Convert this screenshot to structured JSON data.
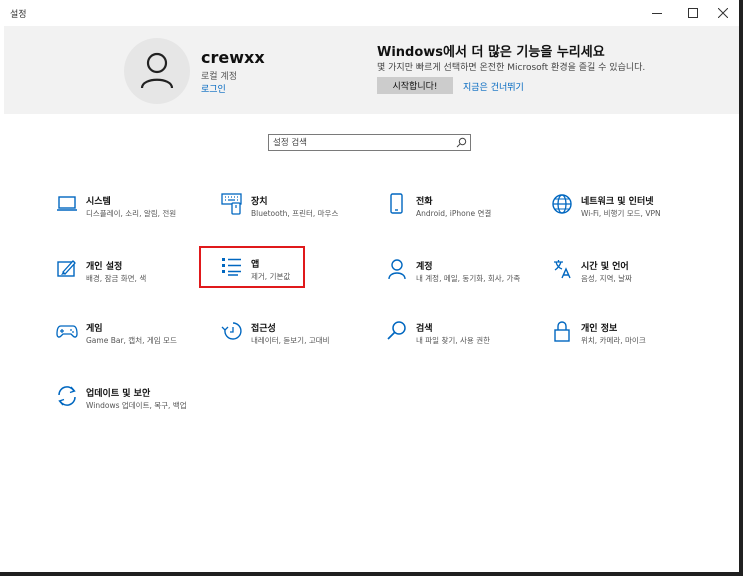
{
  "window": {
    "title": "설정"
  },
  "account": {
    "name": "crewxx",
    "type": "로컬 계정",
    "signin_link": "로그인"
  },
  "promo": {
    "title": "Windows에서 더 많은 기능을 누리세요",
    "description": "몇 가지만 빠르게 선택하면 온전한 Microsoft 환경을 즐길 수 있습니다.",
    "start_button": "시작합니다!",
    "skip_link": "지금은 건너뛰기"
  },
  "search": {
    "placeholder": "설정 검색"
  },
  "accent_color": "#0067c0",
  "highlight_color": "#e0191b",
  "tiles": [
    {
      "name": "시스템",
      "desc": "디스플레이, 소리, 알림, 전원",
      "icon": "laptop-icon"
    },
    {
      "name": "장치",
      "desc": "Bluetooth, 프린터, 마우스",
      "icon": "keyboard-icon"
    },
    {
      "name": "전화",
      "desc": "Android, iPhone 연결",
      "icon": "phone-icon"
    },
    {
      "name": "네트워크 및 인터넷",
      "desc": "Wi-Fi, 비행기 모드, VPN",
      "icon": "globe-icon"
    },
    {
      "name": "개인 설정",
      "desc": "배경, 잠금 화면, 색",
      "icon": "paint-icon"
    },
    {
      "name": "앱",
      "desc": "제거, 기본값",
      "icon": "apps-list-icon"
    },
    {
      "name": "계정",
      "desc": "내 계정, 메일, 동기화, 회사, 가족",
      "icon": "person-icon"
    },
    {
      "name": "시간 및 언어",
      "desc": "음성, 지역, 날짜",
      "icon": "time-language-icon"
    },
    {
      "name": "게임",
      "desc": "Game Bar, 캡처, 게임 모드",
      "icon": "gamepad-icon"
    },
    {
      "name": "접근성",
      "desc": "내레이터, 돋보기, 고대비",
      "icon": "accessibility-icon"
    },
    {
      "name": "검색",
      "desc": "내 파일 찾기, 사용 권한",
      "icon": "magnifier-icon"
    },
    {
      "name": "개인 정보",
      "desc": "위치, 카메라, 마이크",
      "icon": "lock-icon"
    },
    {
      "name": "업데이트 및 보안",
      "desc": "Windows 업데이트, 복구, 백업",
      "icon": "update-icon"
    }
  ]
}
